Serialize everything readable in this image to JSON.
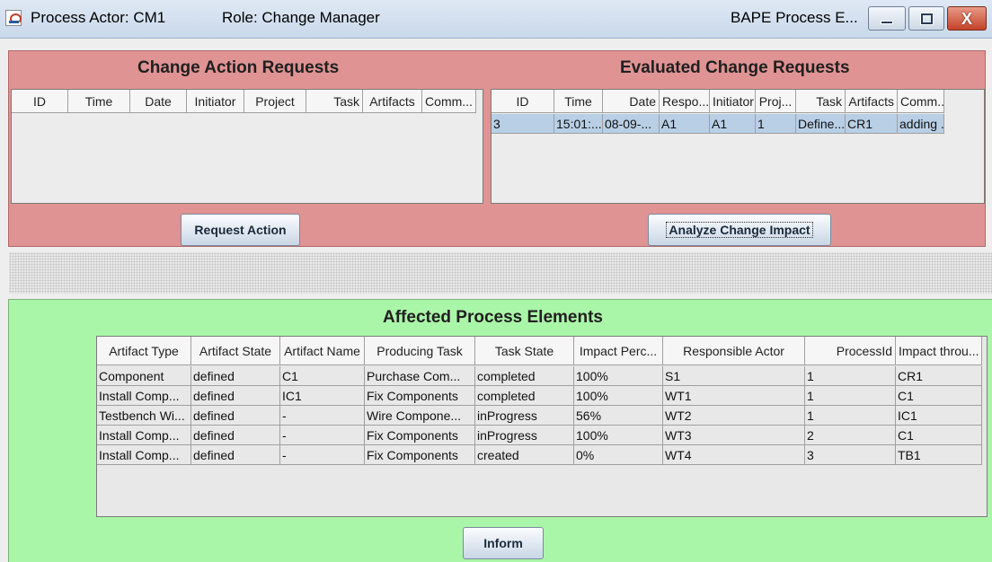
{
  "window": {
    "actor_label": "Process Actor: CM1",
    "role_label": "Role: Change Manager",
    "app_title": "BAPE Process E...",
    "minimize": "",
    "maximize": "",
    "close": "X"
  },
  "change_action_requests": {
    "title": "Change Action Requests",
    "columns": [
      "ID",
      "Time",
      "Date",
      "Initiator",
      "Project",
      "Task",
      "Artifacts",
      "Comm..."
    ],
    "rows": [],
    "button": "Request Action"
  },
  "evaluated_change_requests": {
    "title": "Evaluated Change Requests",
    "columns": [
      "ID",
      "Time",
      "Date",
      "Respo...",
      "Initiator",
      "Proj...",
      "Task",
      "Artifacts",
      "Comm..."
    ],
    "rows": [
      [
        "3",
        "15:01:...",
        "08-09-...",
        "A1",
        "A1",
        "1",
        "Define...",
        "CR1",
        "adding ..."
      ]
    ],
    "button": "Analyze Change Impact"
  },
  "affected_process_elements": {
    "title": "Affected Process Elements",
    "columns": [
      "Artifact Type",
      "Artifact State",
      "Artifact Name",
      "Producing Task",
      "Task State",
      "Impact Perc...",
      "Responsible Actor",
      "ProcessId",
      "Impact throu..."
    ],
    "rows": [
      [
        "Component",
        "defined",
        "C1",
        "Purchase Com...",
        "completed",
        "100%",
        "S1",
        "1",
        "CR1"
      ],
      [
        "Install Comp...",
        "defined",
        "IC1",
        "Fix Components",
        "completed",
        "100%",
        "WT1",
        "1",
        "C1"
      ],
      [
        "Testbench Wi...",
        "defined",
        "-",
        "Wire Compone...",
        "inProgress",
        "56%",
        "WT2",
        "1",
        "IC1"
      ],
      [
        "Install Comp...",
        "defined",
        "-",
        "Fix Components",
        "inProgress",
        "100%",
        "WT3",
        "2",
        "C1"
      ],
      [
        "Install Comp...",
        "defined",
        "-",
        "Fix Components",
        "created",
        "0%",
        "WT4",
        "3",
        "TB1"
      ]
    ],
    "button": "Inform"
  },
  "colors": {
    "red_panel": "#e09393",
    "green_panel": "#aaf6a8",
    "selected_row": "#b8cfe5"
  }
}
